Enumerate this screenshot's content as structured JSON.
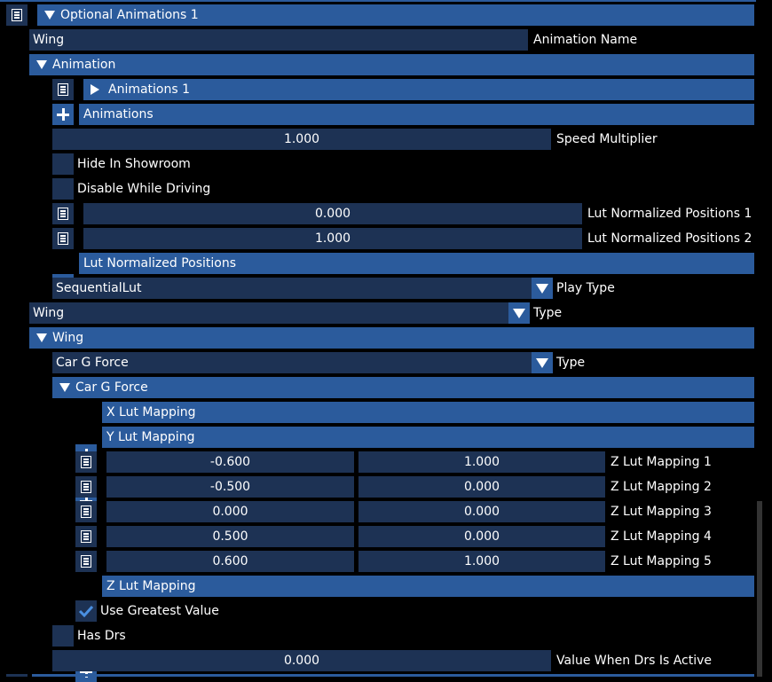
{
  "optional_animations": {
    "header": "Optional Animations 1",
    "animation_name_value": "Wing",
    "animation_name_label": "Animation Name",
    "animation_header": "Animation",
    "animations_item": "Animations 1",
    "animations_add": "Animations",
    "speed_multiplier_value": "1.000",
    "speed_multiplier_label": "Speed Multiplier",
    "hide_in_showroom": "Hide In Showroom",
    "disable_while_driving": "Disable While Driving",
    "lut_positions": [
      {
        "value": "0.000",
        "label": "Lut Normalized Positions 1"
      },
      {
        "value": "1.000",
        "label": "Lut Normalized Positions 2"
      }
    ],
    "lut_positions_add": "Lut Normalized Positions",
    "play_type_value": "SequentialLut",
    "play_type_label": "Play Type",
    "type_value": "Wing",
    "type_label": "Type",
    "wing_header": "Wing",
    "wing_type_value": "Car G Force",
    "wing_type_label": "Type",
    "car_g_force_header": "Car G Force",
    "x_lut_add": "X Lut Mapping",
    "y_lut_add": "Y Lut Mapping",
    "z_lut": [
      {
        "a": "-0.600",
        "b": "1.000",
        "label": "Z Lut Mapping 1"
      },
      {
        "a": "-0.500",
        "b": "0.000",
        "label": "Z Lut Mapping 2"
      },
      {
        "a": "0.000",
        "b": "0.000",
        "label": "Z Lut Mapping 3"
      },
      {
        "a": "0.500",
        "b": "0.000",
        "label": "Z Lut Mapping 4"
      },
      {
        "a": "0.600",
        "b": "1.000",
        "label": "Z Lut Mapping 5"
      }
    ],
    "z_lut_add": "Z Lut Mapping",
    "use_greatest_value": "Use Greatest Value",
    "has_drs": "Has Drs",
    "drs_value": "0.000",
    "drs_label": "Value When Drs Is Active"
  },
  "colors": {
    "header_bg": "#2b5b9c",
    "field_bg": "#1d3254",
    "background": "#000000",
    "check_mark": "#4a90e2"
  },
  "icons": [
    "list-icon",
    "triangle-down-icon",
    "triangle-right-icon",
    "plus-icon",
    "check-icon",
    "dropdown-arrow-icon"
  ]
}
